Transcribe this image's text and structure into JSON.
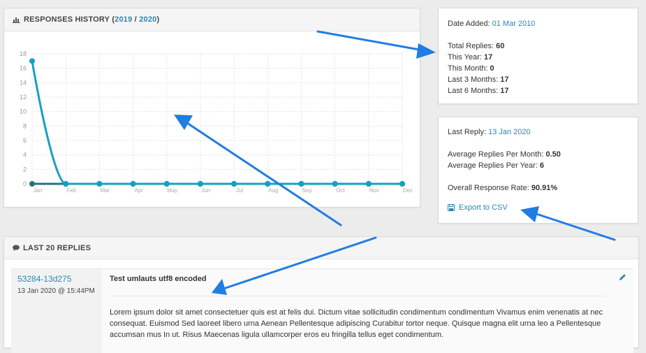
{
  "history": {
    "title_prefix": "RESPONSES HISTORY (",
    "year_a": "2019",
    "sep": " / ",
    "year_b": "2020",
    "title_suffix": ")",
    "icon": "bar-chart-icon"
  },
  "chart_data": {
    "type": "line",
    "categories": [
      "Jan",
      "Feb",
      "Mar",
      "Apr",
      "May",
      "Jun",
      "Jul",
      "Aug",
      "Sep",
      "Oct",
      "Nov",
      "Dec"
    ],
    "series": [
      {
        "values": [
          17,
          0,
          0,
          0,
          0,
          0,
          0,
          0,
          0,
          0,
          0,
          0
        ],
        "color": "#16a0bf"
      },
      {
        "values": [
          0,
          0,
          0,
          0,
          0,
          0,
          0,
          0,
          0,
          0,
          0,
          0
        ],
        "color": "#2a6f86"
      }
    ],
    "ylim": [
      0,
      18
    ],
    "yticks": [
      0,
      2,
      4,
      6,
      8,
      10,
      12,
      14,
      16,
      18
    ],
    "grid": true,
    "xlabel": "",
    "ylabel": ""
  },
  "stats": {
    "date_added_label": "Date Added:",
    "date_added_value": "01 Mar 2010",
    "total_label": "Total Replies:",
    "total_value": "60",
    "year_label": "This Year:",
    "year_value": "17",
    "month_label": "This Month:",
    "month_value": "0",
    "last3_label": "Last 3 Months:",
    "last3_value": "17",
    "last6_label": "Last 6 Months:",
    "last6_value": "17"
  },
  "reply_stats": {
    "last_reply_label": "Last Reply:",
    "last_reply_value": "13 Jan 2020",
    "avg_month_label": "Average Replies Per Month:",
    "avg_month_value": "0.50",
    "avg_year_label": "Average Replies Per Year:",
    "avg_year_value": "6",
    "rate_label": "Overall Response Rate:",
    "rate_value": "90.91%",
    "export_label": "Export to CSV",
    "export_icon": "save-icon"
  },
  "replies": {
    "title": "LAST 20 REPLIES",
    "icon": "comment-icon",
    "items": [
      {
        "id": "53284-13d275",
        "date": "13 Jan 2020 @ 15:44PM",
        "subject": "Test umlauts utf8 encoded",
        "body": "Lorem ipsum dolor sit amet consectetuer quis est at felis dui. Dictum vitae sollicitudin condimentum condimentum Vivamus enim venenatis at nec consequat. Euismod Sed laoreet libero urna Aenean Pellentesque adipiscing Curabitur tortor neque. Quisque magna elit urna leo a Pellentesque accumsan mus In ut. Risus Maecenas ligula ullamcorper eros eu fringilla tellus eget condimentum."
      }
    ]
  },
  "annotation_color": "#1f7de3"
}
